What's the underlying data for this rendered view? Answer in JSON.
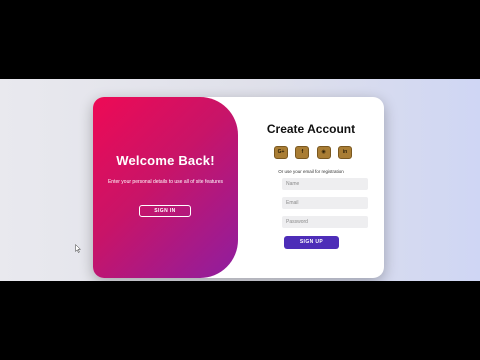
{
  "welcome": {
    "title": "Welcome Back!",
    "text": "Enter your personal details to use all of site features",
    "signin_label": "SIGN IN"
  },
  "register": {
    "title": "Create Account",
    "socials": [
      {
        "label": "G+",
        "icon": "google-plus-icon"
      },
      {
        "label": "f",
        "icon": "facebook-icon"
      },
      {
        "label": "◉",
        "icon": "github-icon"
      },
      {
        "label": "in",
        "icon": "linkedin-icon"
      }
    ],
    "alt_text": "Or use your email for registration",
    "name_placeholder": "Name",
    "email_placeholder": "Email",
    "password_placeholder": "Password",
    "signup_label": "SIGN UP"
  },
  "colors": {
    "gradient_start": "#ee0a55",
    "gradient_end": "#8e1ea0",
    "social_bg": "#a97d34",
    "signup_bg": "#4d2db8"
  }
}
